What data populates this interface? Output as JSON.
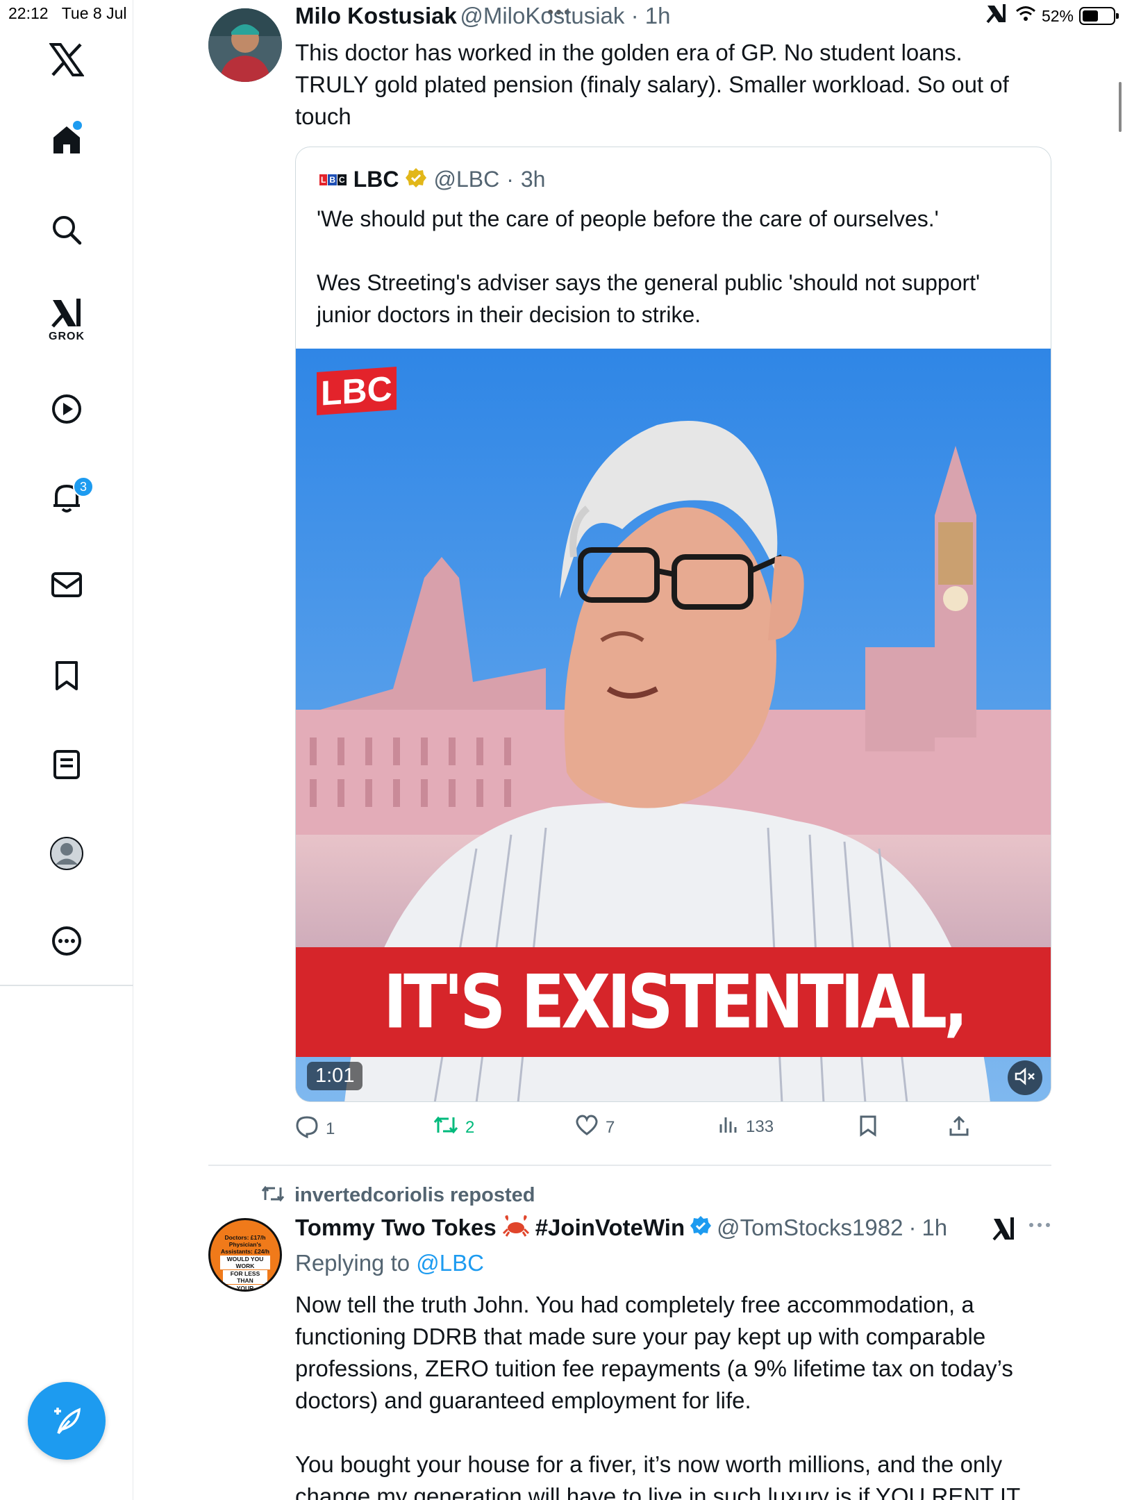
{
  "status_bar": {
    "time": "22:12",
    "date": "Tue 8 Jul",
    "battery": "52%",
    "battery_level": 0.52
  },
  "sidebar": {
    "items": [
      {
        "name": "home",
        "label": "Home"
      },
      {
        "name": "search",
        "label": "Search"
      },
      {
        "name": "grok",
        "label": "GROK"
      },
      {
        "name": "video",
        "label": "Video"
      },
      {
        "name": "notifications",
        "label": "Notifications",
        "badge": "3"
      },
      {
        "name": "messages",
        "label": "Messages"
      },
      {
        "name": "bookmarks",
        "label": "Bookmarks"
      },
      {
        "name": "lists",
        "label": "Lists"
      },
      {
        "name": "profile",
        "label": "Profile"
      },
      {
        "name": "more",
        "label": "More"
      }
    ],
    "brand_color": "#1d9bf0"
  },
  "post1": {
    "name": "Milo Kostusiak",
    "handle": "@MiloKostusiak",
    "time": "1h",
    "text_lines": [
      "This doctor has worked in the golden era of GP. No student loans.",
      "TRULY gold plated pension (finaly salary). Smaller workload. So out of",
      "touch"
    ],
    "quote": {
      "logo": "LBC",
      "name": "LBC",
      "handle": "@LBC",
      "time": "3h",
      "text1": "'We should put the care of people before the care of ourselves.'",
      "text2_lines": [
        "Wes Streeting's adviser says the general public 'should not support'",
        "junior doctors in their decision to strike."
      ],
      "video": {
        "logo": "LBC",
        "caption": "IT'S EXISTENTIAL,",
        "duration": "1:01"
      }
    },
    "actions": {
      "replies": "1",
      "reposts": "2",
      "likes": "7",
      "views": "133"
    }
  },
  "post2": {
    "reposted_by": "invertedcoriolis reposted",
    "name": "Tommy Two Tokes",
    "name_suffix": "#JoinVoteWin",
    "handle": "@TomStocks1982",
    "time": "1h",
    "replying_label": "Replying to",
    "replying_handle": "@LBC",
    "avatar_text_lines": [
      "Doctors: £17/h",
      "Physician's",
      "Assistants: £24/h",
      "WOULD YOU WORK",
      "FOR LESS THAN",
      "YOUR ASSISTANT?"
    ],
    "paragraph1_lines": [
      "Now tell the truth John. You had completely free accommodation, a",
      "functioning DDRB that made sure your pay kept up with comparable",
      "professions, ZERO tuition fee repayments (a 9% lifetime tax on today’s",
      "doctors) and guaranteed employment for life."
    ],
    "paragraph2_lines": [
      "You bought your house for a fiver, it’s now worth millions, and the only",
      "change my generation will have to live in such luxury is if YOU RENT IT"
    ]
  }
}
